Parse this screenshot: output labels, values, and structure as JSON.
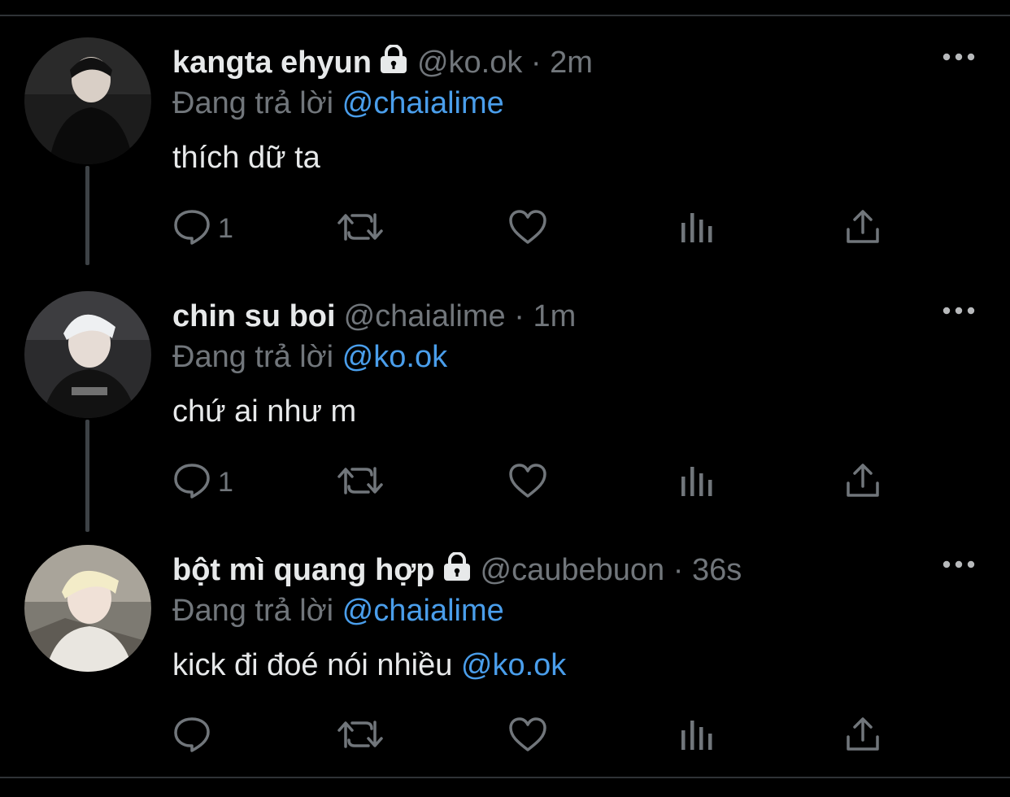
{
  "colors": {
    "background": "#000000",
    "text": "#e7e9ea",
    "muted": "#71767b",
    "mention": "#4a9eeb",
    "divider": "#2f3336"
  },
  "reply_prefix": "Đang trả lời",
  "tweets": [
    {
      "name": "kangta ehyun",
      "protected": true,
      "handle": "@ko.ok",
      "separator": "·",
      "time": "2m",
      "replying_to": "@chaialime",
      "text": "thích dữ ta",
      "text_mention": "",
      "reply_count": "1",
      "icons": [
        "reply-icon",
        "retweet-icon",
        "like-icon",
        "analytics-icon",
        "share-icon",
        "more-icon"
      ]
    },
    {
      "name": "chin su boi",
      "protected": false,
      "handle": "@chaialime",
      "separator": "·",
      "time": "1m",
      "replying_to": "@ko.ok",
      "text": "chứ ai như m",
      "text_mention": "",
      "reply_count": "1",
      "icons": [
        "reply-icon",
        "retweet-icon",
        "like-icon",
        "analytics-icon",
        "share-icon",
        "more-icon"
      ]
    },
    {
      "name": "bột mì quang hợp",
      "protected": true,
      "handle": "@caubebuon",
      "separator": "·",
      "time": "36s",
      "replying_to": "@chaialime",
      "text": "kick đi đoé nói nhiều ",
      "text_mention": "@ko.ok",
      "reply_count": "",
      "icons": [
        "reply-icon",
        "retweet-icon",
        "like-icon",
        "analytics-icon",
        "share-icon",
        "more-icon"
      ]
    }
  ]
}
